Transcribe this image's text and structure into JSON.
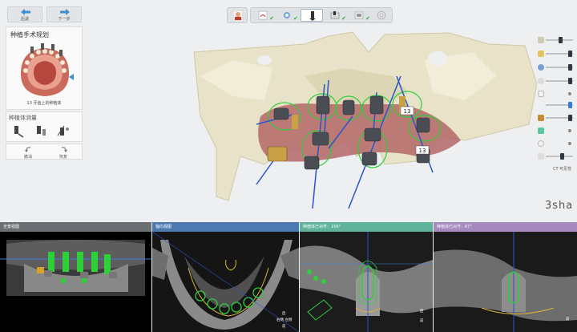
{
  "nav": {
    "back_label": "后退",
    "next_label": "下一步"
  },
  "planning_panel": {
    "title": "种植手术规划",
    "caption": "13 牙齿上的种植体"
  },
  "implant_measure": {
    "title": "种植体测量"
  },
  "undo": {
    "undo_label": "撤消",
    "redo_label": "恢复"
  },
  "workflow": {
    "steps": [
      "user",
      "scan",
      "segment",
      "implant",
      "guide",
      "export",
      "disc"
    ],
    "active_index": 3
  },
  "view3d": {
    "tooth_tags": [
      "13",
      "13"
    ]
  },
  "right_tools": {
    "ct_label": "CT 可见性"
  },
  "brand": {
    "logo": "3sha"
  },
  "panes": [
    {
      "title": "全景视图",
      "color": "#6b6e72"
    },
    {
      "title": "轴向视图",
      "color": "#4c7ab0"
    },
    {
      "title": "种植体已对齐：156°",
      "color": "#5fb39a"
    },
    {
      "title": "种植体已对齐：67°",
      "color": "#a58abf"
    }
  ],
  "hud_labels": {
    "axial": [
      "后",
      "右侧 左侧",
      "前"
    ],
    "cross1": [
      "后",
      "前"
    ],
    "cross2": [
      "前"
    ]
  },
  "colors": {
    "implant_green": "#2fcf3a",
    "bone": "#e8e3c8",
    "gum": "#b56b6b"
  }
}
